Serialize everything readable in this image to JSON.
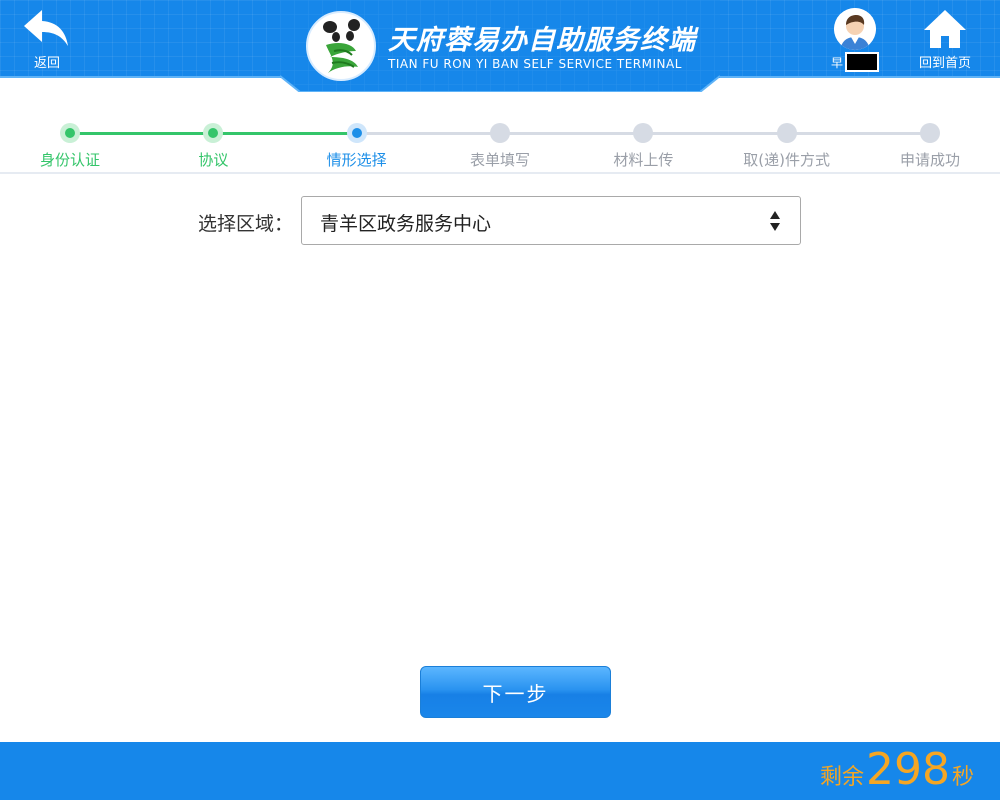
{
  "header": {
    "back_label": "返回",
    "title_cn": "天府蓉易办自助服务终端",
    "title_en": "TIAN FU RON YI BAN SELF SERVICE TERMINAL",
    "user_name": "早",
    "home_label": "回到首页"
  },
  "steps": {
    "current_index": 2,
    "items": [
      {
        "label": "身份认证",
        "status": "done"
      },
      {
        "label": "协议",
        "status": "done"
      },
      {
        "label": "情形选择",
        "status": "current"
      },
      {
        "label": "表单填写",
        "status": "pending"
      },
      {
        "label": "材料上传",
        "status": "pending"
      },
      {
        "label": "取(递)件方式",
        "status": "pending"
      },
      {
        "label": "申请成功",
        "status": "pending"
      }
    ]
  },
  "region": {
    "label": "选择区域：",
    "selected": "青羊区政务服务中心"
  },
  "next_button": "下一步",
  "footer": {
    "countdown_prefix": "剩余",
    "countdown_value": "298",
    "countdown_unit": "秒"
  },
  "colors": {
    "brand_blue": "#1687ea",
    "step_done": "#34c56a",
    "step_current": "#1d8fe8",
    "step_pending": "#d6dbe4",
    "countdown": "#f5a623"
  }
}
